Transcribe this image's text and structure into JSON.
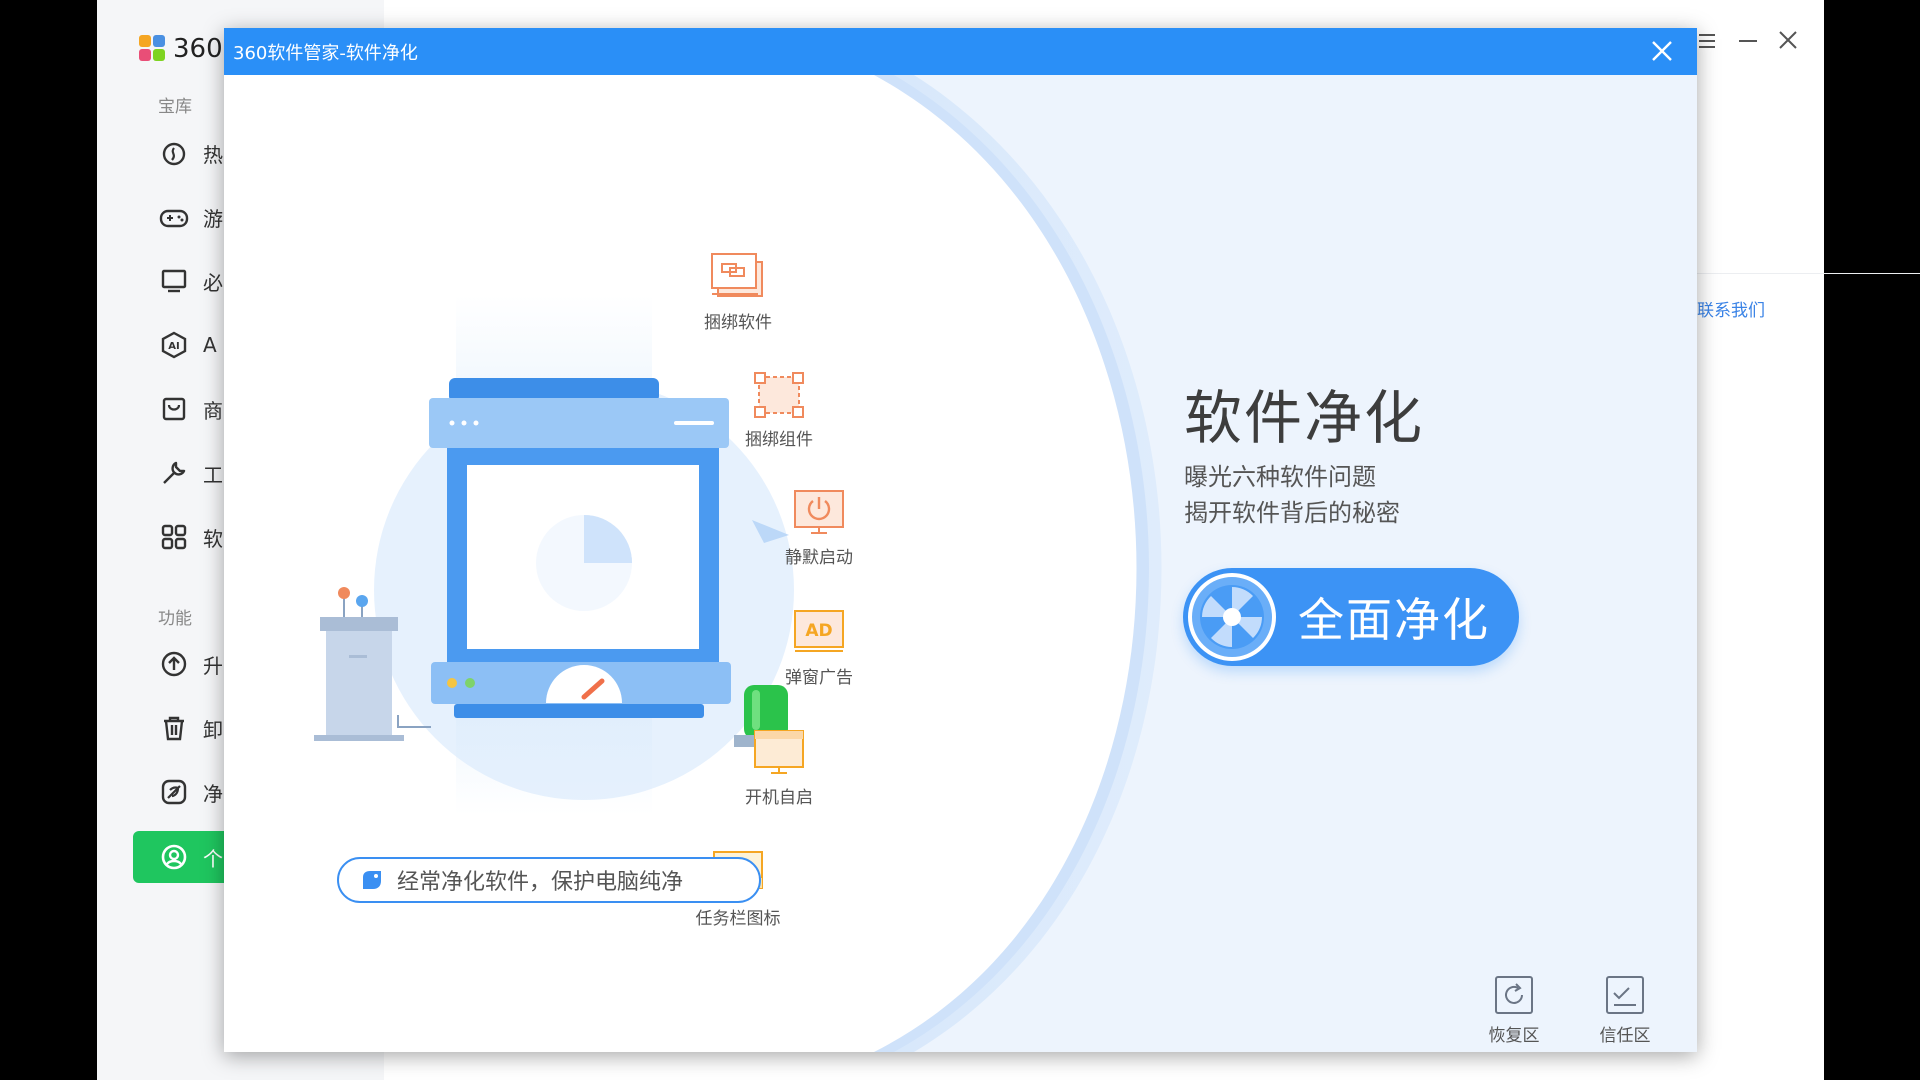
{
  "background_window": {
    "logo_text": "360",
    "sections": [
      "宝库",
      "功能"
    ],
    "nav_items": [
      {
        "label": "热",
        "icon": "fire-icon"
      },
      {
        "label": "游",
        "icon": "gamepad-icon"
      },
      {
        "label": "必",
        "icon": "monitor-icon"
      },
      {
        "label": "A",
        "icon": "ai-hexagon-icon"
      },
      {
        "label": "商",
        "icon": "store-icon"
      },
      {
        "label": "工",
        "icon": "wrench-icon"
      },
      {
        "label": "软",
        "icon": "grid-icon"
      },
      {
        "label": "升",
        "icon": "upgrade-arrow-icon"
      },
      {
        "label": "卸",
        "icon": "trash-icon"
      },
      {
        "label": "净",
        "icon": "clean-leaf-icon"
      },
      {
        "label": "个",
        "icon": "user-circle-icon"
      }
    ],
    "contact_link": "联系我们"
  },
  "dialog": {
    "title": "360软件管家-软件净化",
    "heading": "软件净化",
    "subtitle_lines": [
      "曝光六种软件问题",
      "揭开软件背后的秘密"
    ],
    "primary_button": "全面净化",
    "tip": "经常净化软件，保护电脑纯净",
    "features": [
      {
        "label": "捆绑软件",
        "icon": "bundled-software-icon"
      },
      {
        "label": "捆绑组件",
        "icon": "bundled-component-icon"
      },
      {
        "label": "静默启动",
        "icon": "silent-start-icon"
      },
      {
        "label": "弹窗广告",
        "icon": "popup-ad-icon"
      },
      {
        "label": "开机自启",
        "icon": "autostart-icon"
      },
      {
        "label": "任务栏图标",
        "icon": "taskbar-icon"
      }
    ],
    "bottom_tools": [
      {
        "label": "恢复区",
        "icon": "restore-icon"
      },
      {
        "label": "信任区",
        "icon": "trust-icon"
      }
    ]
  },
  "colors": {
    "title_bar": "#2a8ff7",
    "primary": "#3c93f5",
    "feature_icon": "#f08a5d",
    "active_nav": "#1fc65f",
    "panel_bg": "#edf4fd"
  }
}
